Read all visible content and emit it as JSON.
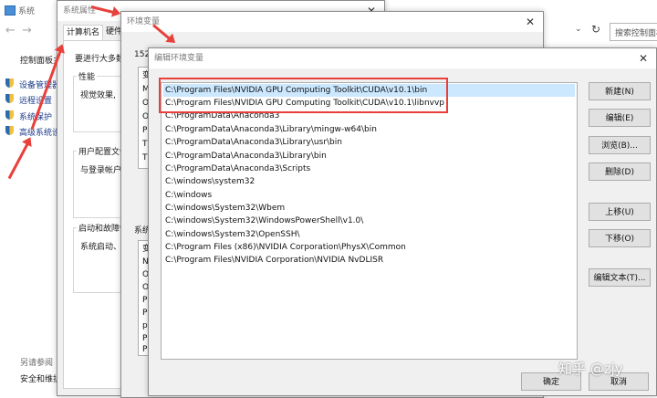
{
  "system": {
    "title": "系统",
    "breadcrumb_label": "控制面板主",
    "links": [
      {
        "label": "设备管理器",
        "icon": "shield-icon"
      },
      {
        "label": "远程设置",
        "icon": "shield-icon"
      },
      {
        "label": "系统保护",
        "icon": "shield-icon"
      },
      {
        "label": "高级系统设",
        "icon": "shield-icon"
      }
    ],
    "see_also": "另请参阅",
    "security": "安全和维护",
    "search_placeholder": "搜索控制面板"
  },
  "sysprops": {
    "title": "系统属性",
    "tabs": [
      "计算机名",
      "硬件"
    ],
    "intro": "要进行大多数",
    "performance_label": "性能",
    "performance_text": "视觉效果,",
    "profile_label": "用户配置文件",
    "profile_text": "与登录帐户",
    "startup_label": "启动和故障恢",
    "startup_text": "系统启动、"
  },
  "envvars": {
    "title": "环境变量",
    "user_label": "152",
    "user_col": [
      "变",
      "M",
      "O",
      "O",
      "P",
      "TI",
      "TI"
    ],
    "system_label": "系统",
    "system_col": [
      "变",
      "N",
      "O",
      "O",
      "P",
      "P",
      "pl",
      "Pl",
      "Pl"
    ]
  },
  "editenv": {
    "title": "编辑环境变量",
    "paths": [
      "C:\\Program Files\\NVIDIA GPU Computing Toolkit\\CUDA\\v10.1\\bin",
      "C:\\Program Files\\NVIDIA GPU Computing Toolkit\\CUDA\\v10.1\\libnvvp",
      "C:\\ProgramData\\Anaconda3",
      "C:\\ProgramData\\Anaconda3\\Library\\mingw-w64\\bin",
      "C:\\ProgramData\\Anaconda3\\Library\\usr\\bin",
      "C:\\ProgramData\\Anaconda3\\Library\\bin",
      "C:\\ProgramData\\Anaconda3\\Scripts",
      "C:\\windows\\system32",
      "C:\\windows",
      "C:\\windows\\System32\\Wbem",
      "C:\\windows\\System32\\WindowsPowerShell\\v1.0\\",
      "C:\\windows\\System32\\OpenSSH\\",
      "C:\\Program Files (x86)\\NVIDIA Corporation\\PhysX\\Common",
      "C:\\Program Files\\NVIDIA Corporation\\NVIDIA NvDLISR"
    ],
    "buttons": {
      "new": "新建(N)",
      "edit": "编辑(E)",
      "browse": "浏览(B)...",
      "delete": "删除(D)",
      "up": "上移(U)",
      "down": "下移(O)",
      "edit_text": "编辑文本(T)...",
      "ok": "确定",
      "cancel": "取消"
    }
  },
  "watermark": "知乎 @zjy",
  "colors": {
    "arrow": "#e8403a",
    "highlight_box": "#e8403a",
    "selection": "#cce8ff"
  }
}
